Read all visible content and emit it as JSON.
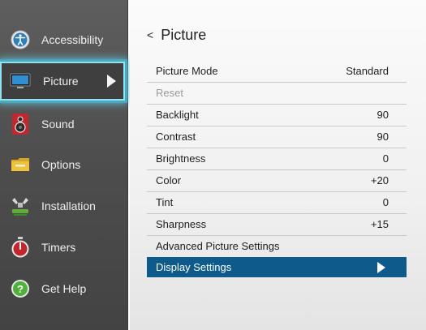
{
  "sidebar": {
    "items": [
      {
        "label": "Accessibility",
        "icon": "accessibility-icon"
      },
      {
        "label": "Picture",
        "icon": "picture-tv-icon",
        "selected": true
      },
      {
        "label": "Sound",
        "icon": "speaker-icon"
      },
      {
        "label": "Options",
        "icon": "options-folder-icon"
      },
      {
        "label": "Installation",
        "icon": "installation-icon"
      },
      {
        "label": "Timers",
        "icon": "timer-icon"
      },
      {
        "label": "Get Help",
        "icon": "help-icon"
      }
    ]
  },
  "panel": {
    "back_label": "<",
    "title": "Picture",
    "rows": [
      {
        "label": "Picture Mode",
        "value": "Standard"
      },
      {
        "label": "Reset",
        "value": "",
        "disabled": true
      },
      {
        "label": "Backlight",
        "value": "90"
      },
      {
        "label": "Contrast",
        "value": "90"
      },
      {
        "label": "Brightness",
        "value": "0"
      },
      {
        "label": "Color",
        "value": "+20"
      },
      {
        "label": "Tint",
        "value": "0"
      },
      {
        "label": "Sharpness",
        "value": "+15"
      },
      {
        "label": "Advanced Picture Settings",
        "value": ""
      },
      {
        "label": "Display Settings",
        "value": "",
        "highlighted": true
      }
    ]
  },
  "colors": {
    "highlight": "#0e5a8a",
    "selection_glow": "#5fc8de",
    "sidebar_bg": "#4d4d4d"
  }
}
